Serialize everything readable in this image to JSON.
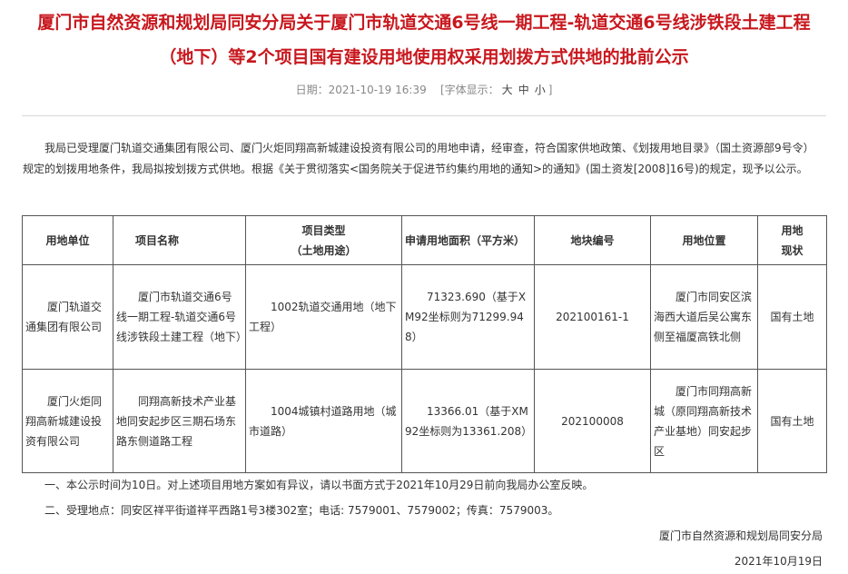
{
  "title": {
    "line1": "厦门市自然资源和规划局同安分局关于厦门市轨道交通6号线一期工程-轨道交通6号线涉铁段土建工程",
    "line2": "（地下）等2个项目国有建设用地使用权采用划拨方式供地的批前公示"
  },
  "meta": {
    "date": "日期：2021-10-19 16:39",
    "font_size_prefix": "[字体显示：",
    "size_large": "大",
    "size_medium": "中",
    "size_small": "小",
    "font_size_suffix": "]"
  },
  "intro": "我局已受理厦门轨道交通集团有限公司、厦门火炬同翔高新城建设投资有限公司的用地申请，经审查，符合国家供地政策、《划拨用地目录》（国土资源部9号令）规定的划拨用地条件，我局拟按划拨方式供地。根据《关于贯彻落实<国务院关于促进节约集约用地的通知>的通知》(国土资发[2008]16号)的规定，现予以公示。",
  "table": {
    "headers": {
      "unit": "用地单位",
      "name": "项目名称",
      "type": "项目类型\n（土地用途）",
      "area": "申请用地面积（平方米）",
      "parcel": "地块编号",
      "location": "用地位置",
      "status": "用地\n现状"
    },
    "rows": [
      {
        "unit": "厦门轨道交通集团有限公司",
        "name": "厦门市轨道交通6号线一期工程-轨道交通6号线涉铁段土建工程（地下）",
        "type": "1002轨道交通用地（地下工程）",
        "area": "71323.690（基于XM92坐标则为71299.948）",
        "parcel": "202100161-1",
        "location": "厦门市同安区滨海西大道后吴公寓东侧至福厦高铁北侧",
        "status": "国有土地"
      },
      {
        "unit": "厦门火炬同翔高新城建设投资有限公司",
        "name": "同翔高新技术产业基地同安起步区三期石场东路东侧道路工程",
        "type": "1004城镇村道路用地（城市道路）",
        "area": "13366.01（基于XM92坐标则为13361.208）",
        "parcel": "202100008",
        "location": "厦门市同翔高新城（原同翔高新技术产业基地）同安起步区",
        "status": "国有土地"
      }
    ]
  },
  "notes": [
    "一、本公示时间为10日。对上述项目用地方案如有异议，请以书面方式于2021年10月29日前向我局办公室反映。",
    "二、受理地点：同安区祥平街道祥平西路1号3楼302室；电话: 7579001、7579002；传真：7579003。"
  ],
  "signature": {
    "org": "厦门市自然资源和规划局同安分局",
    "date": "2021年10月19日"
  },
  "colors": {
    "title": "#c8181e",
    "meta": "#888888",
    "border": "#555555"
  }
}
